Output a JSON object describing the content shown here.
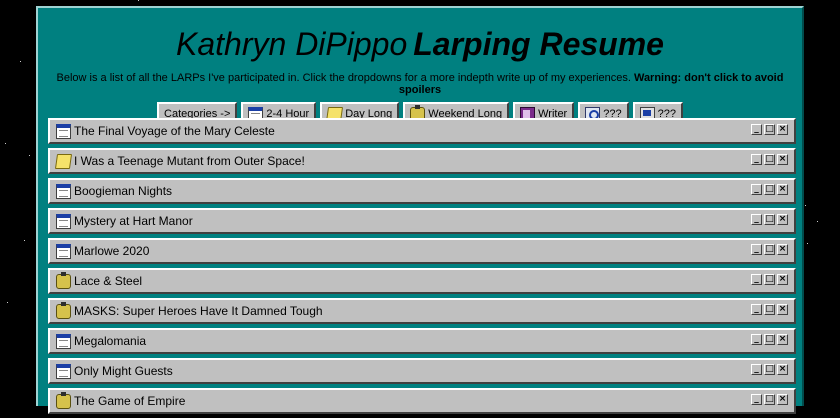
{
  "header": {
    "title_name": "Kathryn DiPippo",
    "title_strong": "Larping Resume",
    "subtitle": "Below is a list of all the LARPs I've participated in. Click the dropdowns for a more indepth write up of my experiences.",
    "warning": "Warning: don't click to avoid spoilers"
  },
  "categories": {
    "lead": "Categories ->",
    "items": [
      {
        "label": "2-4 Hour",
        "icon": "calendar-icon"
      },
      {
        "label": "Day Long",
        "icon": "folder-icon"
      },
      {
        "label": "Weekend Long",
        "icon": "party-icon"
      },
      {
        "label": "Writer",
        "icon": "book-icon"
      },
      {
        "label": "???",
        "icon": "search-icon"
      },
      {
        "label": "???",
        "icon": "computer-icon"
      }
    ]
  },
  "larps": [
    {
      "title": "The Final Voyage of the Mary Celeste",
      "icon": "calendar-icon"
    },
    {
      "title": "I Was a Teenage Mutant from Outer Space!",
      "icon": "folder-icon"
    },
    {
      "title": "Boogieman Nights",
      "icon": "calendar-icon"
    },
    {
      "title": "Mystery at Hart Manor",
      "icon": "calendar-icon"
    },
    {
      "title": "Marlowe 2020",
      "icon": "calendar-icon"
    },
    {
      "title": "Lace & Steel",
      "icon": "party-icon"
    },
    {
      "title": "MASKS: Super Heroes Have It Damned Tough",
      "icon": "party-icon"
    },
    {
      "title": "Megalomania",
      "icon": "calendar-icon"
    },
    {
      "title": "Only Might Guests",
      "icon": "calendar-icon"
    },
    {
      "title": "The Game of Empire",
      "icon": "party-icon"
    }
  ],
  "window_controls": {
    "minimize": "_",
    "maximize": "□",
    "close": "×"
  },
  "colors": {
    "panel": "#008080",
    "background": "#000000",
    "chrome": "#c0c0c0"
  }
}
